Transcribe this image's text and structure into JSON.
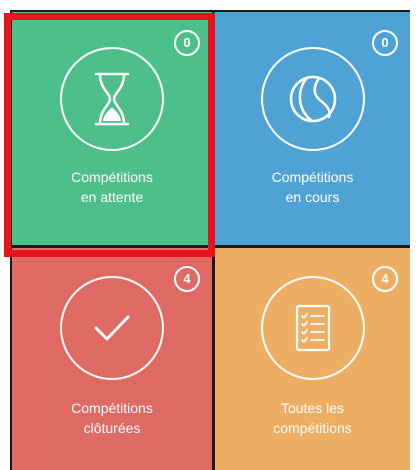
{
  "tiles": {
    "pending": {
      "label_line1": "Compétitions",
      "label_line2": "en attente",
      "count": "0",
      "icon": "hourglass-icon",
      "color": "#4dbf8a"
    },
    "current": {
      "label_line1": "Compétitions",
      "label_line2": "en cours",
      "count": "0",
      "icon": "tennis-ball-icon",
      "color": "#4fa3d4"
    },
    "closed": {
      "label_line1": "Compétitions",
      "label_line2": "clôturées",
      "count": "4",
      "icon": "checkmark-icon",
      "color": "#df6a64"
    },
    "all": {
      "label_line1": "Toutes les",
      "label_line2": "compétitions",
      "count": "4",
      "icon": "checklist-icon",
      "color": "#edad62"
    }
  },
  "highlight": {
    "target": "pending",
    "color": "#e8141b"
  }
}
